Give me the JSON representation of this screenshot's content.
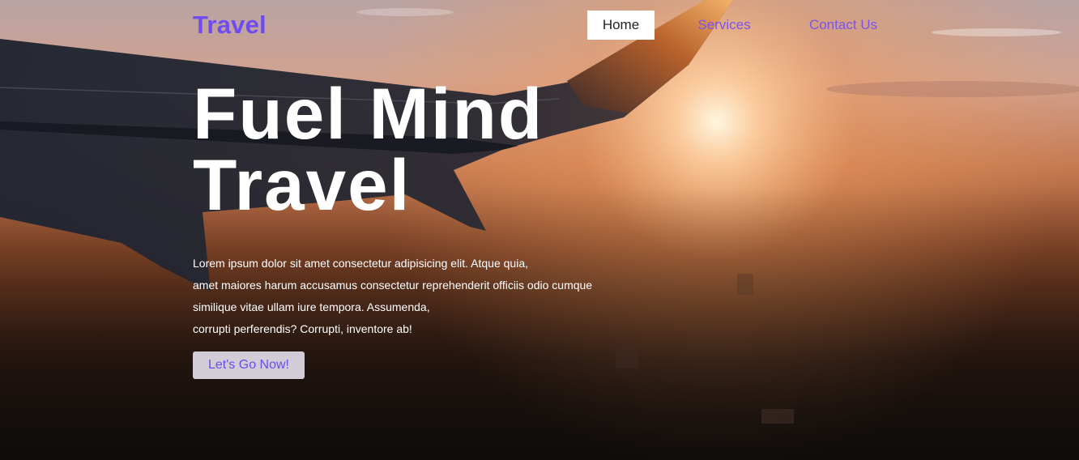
{
  "navbar": {
    "logo": "Travel",
    "links": [
      {
        "label": "Home",
        "active": true
      },
      {
        "label": "Services",
        "active": false
      },
      {
        "label": "Contact Us",
        "active": false
      }
    ]
  },
  "hero": {
    "headline_lines": [
      "Fuel Mind",
      "Travel"
    ],
    "intro_lines": [
      "Lorem ipsum dolor sit amet consectetur adipisicing elit. Atque quia,",
      "amet maiores harum accusamus consectetur reprehenderit officiis odio cumque",
      "similique vitae ullam iure tempora. Assumenda,",
      "corrupti perferendis? Corrupti, inventore ab!"
    ],
    "cta_label": "Let's Go Now!"
  },
  "colors": {
    "accent": "#6f4cf0",
    "link": "#7a55e8",
    "active_bg": "#ffffff",
    "cta_bg": "#d1ccd6"
  }
}
